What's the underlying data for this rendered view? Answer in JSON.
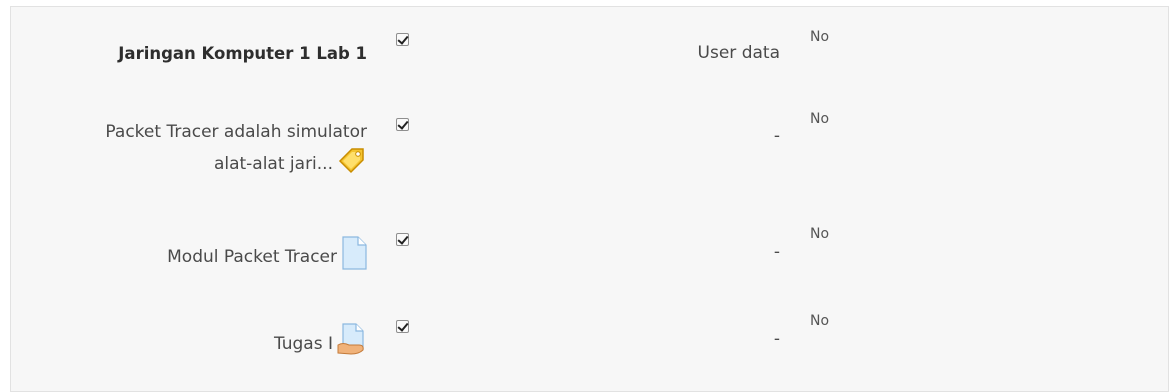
{
  "rows": [
    {
      "label": "Jaringan Komputer 1 Lab 1",
      "user_data": "User data",
      "value": "No",
      "icon": "none"
    },
    {
      "label_line1": "Packet Tracer adalah simulator",
      "label_line2": "alat-alat jari...",
      "user_data": "-",
      "value": "No",
      "icon": "label-tag-icon"
    },
    {
      "label": "Modul Packet Tracer",
      "user_data": "-",
      "value": "No",
      "icon": "file-icon"
    },
    {
      "label": "Tugas I",
      "user_data": "-",
      "value": "No",
      "icon": "assignment-icon"
    }
  ]
}
